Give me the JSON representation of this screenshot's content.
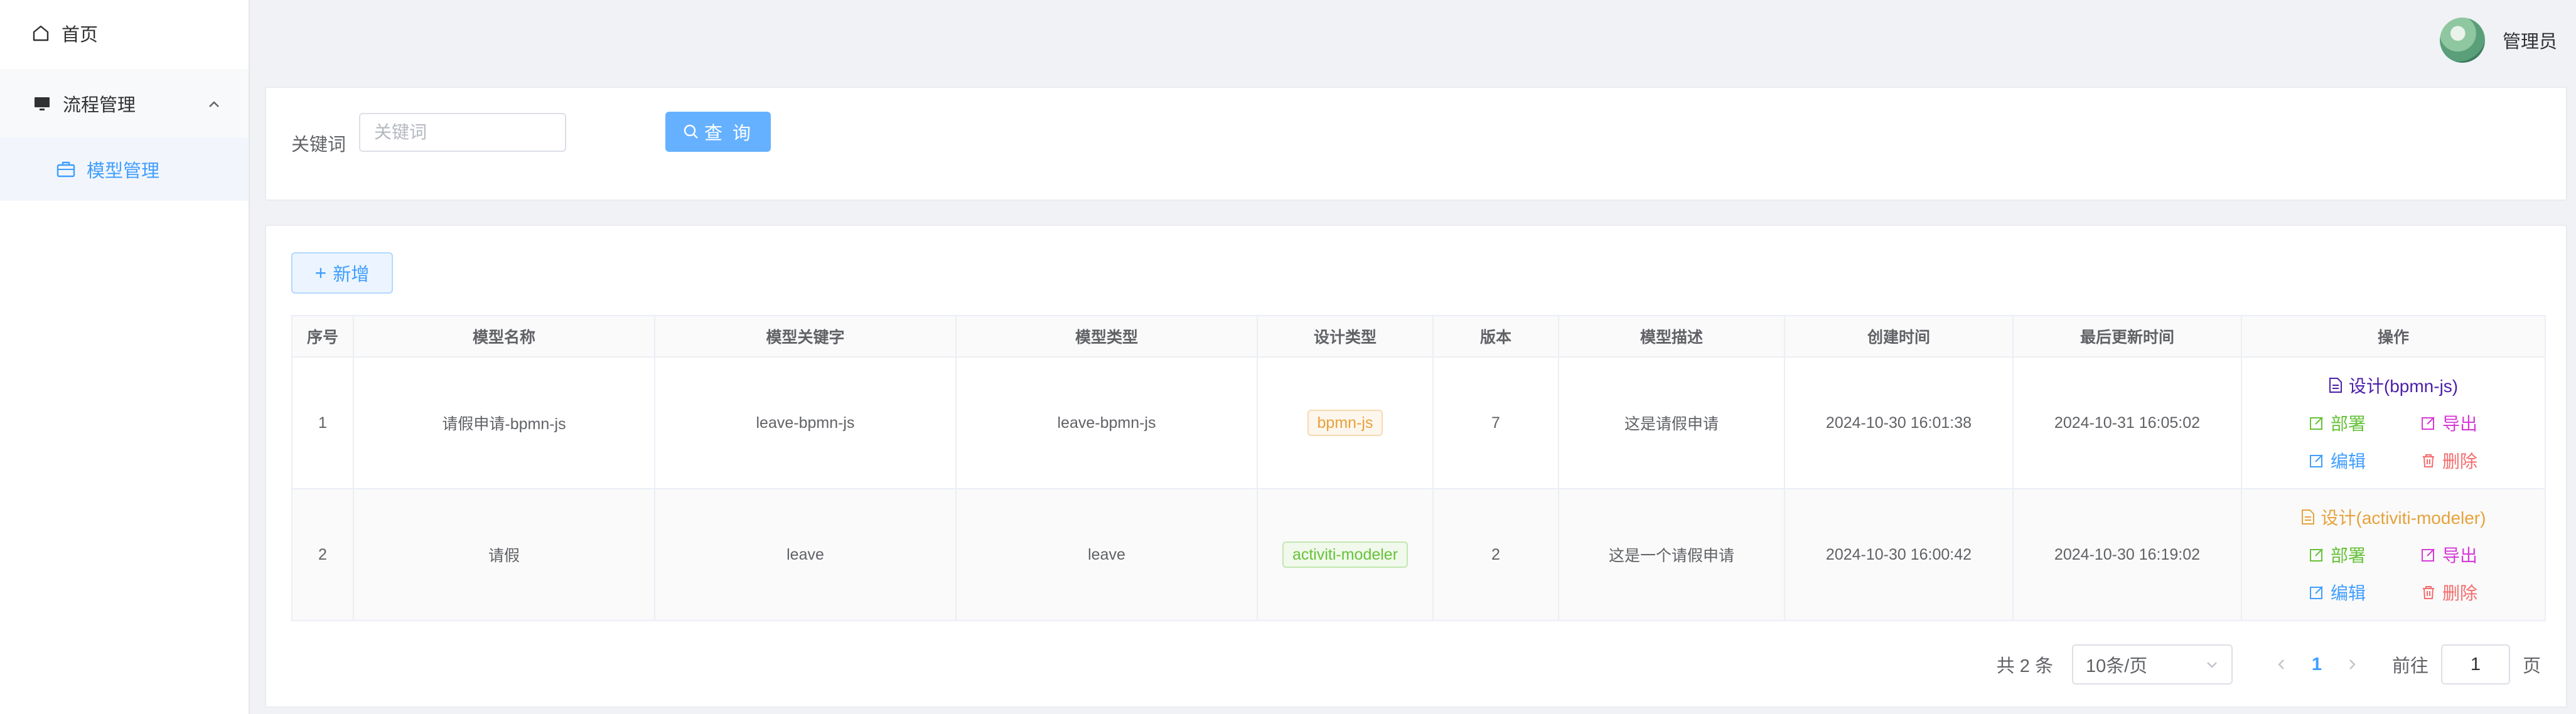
{
  "sidebar": {
    "home_label": "首页",
    "group_label": "流程管理",
    "model_label": "模型管理"
  },
  "header": {
    "username": "管理员"
  },
  "search": {
    "label": "关键词",
    "placeholder": "关键词",
    "button_label": "查 询"
  },
  "toolbar": {
    "add_label": "新增"
  },
  "table": {
    "columns": [
      "序号",
      "模型名称",
      "模型关键字",
      "模型类型",
      "设计类型",
      "版本",
      "模型描述",
      "创建时间",
      "最后更新时间",
      "操作"
    ],
    "rows": [
      {
        "index": "1",
        "name": "请假申请-bpmn-js",
        "key": "leave-bpmn-js",
        "type": "leave-bpmn-js",
        "design_type": "bpmn-js",
        "version": "7",
        "description": "这是请假申请",
        "created": "2024-10-30 16:01:38",
        "updated": "2024-10-31 16:05:02",
        "design_action": "设计(bpmn-js)"
      },
      {
        "index": "2",
        "name": "请假",
        "key": "leave",
        "type": "leave",
        "design_type": "activiti-modeler",
        "version": "2",
        "description": "这是一个请假申请",
        "created": "2024-10-30 16:00:42",
        "updated": "2024-10-30 16:19:02",
        "design_action": "设计(activiti-modeler)"
      }
    ],
    "actions": {
      "deploy": "部署",
      "export": "导出",
      "edit": "编辑",
      "delete": "删除"
    }
  },
  "pagination": {
    "total_text": "共 2 条",
    "page_size": "10条/页",
    "current_page": "1",
    "goto_label": "前往",
    "goto_value": "1",
    "page_suffix": "页"
  },
  "colors": {
    "primary": "#409eff",
    "success": "#67c23a",
    "warning": "#e6a23c",
    "danger": "#f56c6c",
    "export": "#d63ad6",
    "design_bpmn": "#4b1fa8",
    "design_activiti": "#e6a23c"
  }
}
